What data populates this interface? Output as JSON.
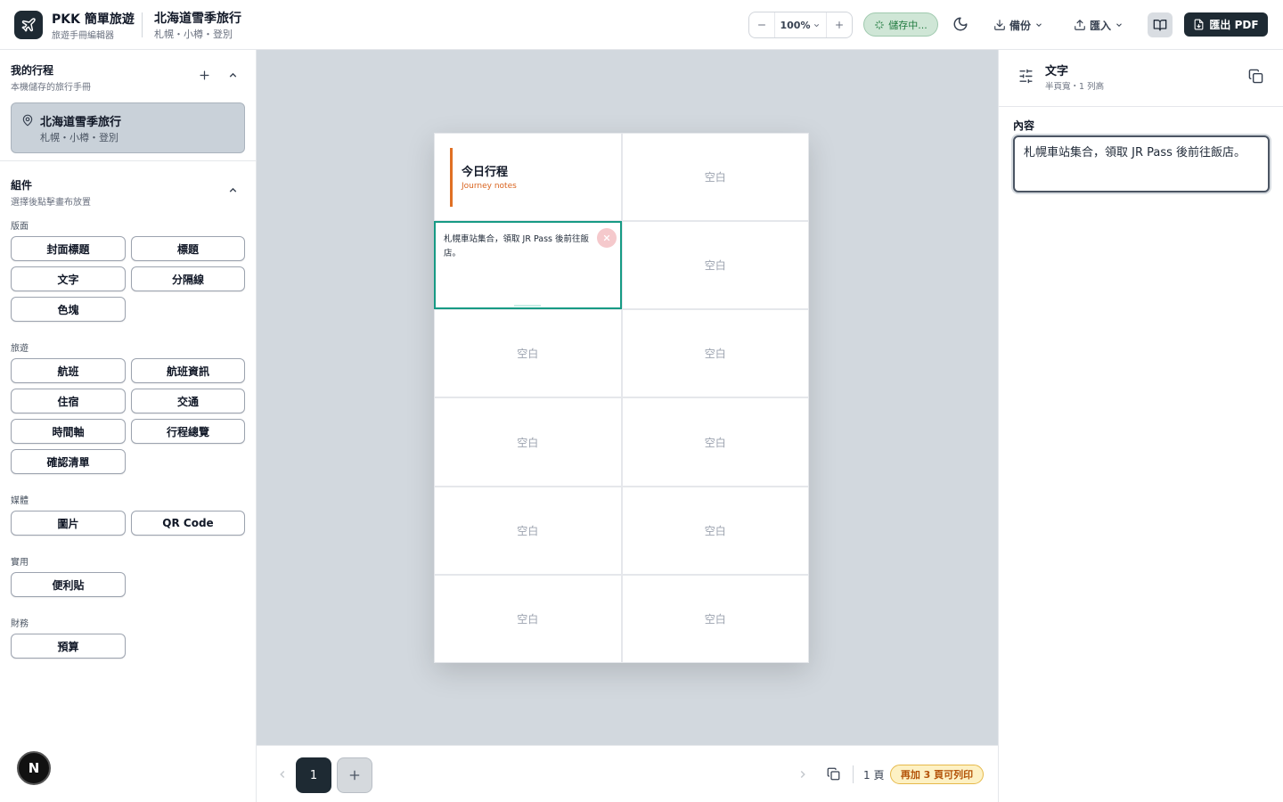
{
  "header": {
    "app_name": "PKK 簡單旅遊",
    "app_subtitle": "旅遊手冊編輯器",
    "trip_name": "北海道雪季旅行",
    "trip_locations": "札幌・小樽・登別",
    "zoom_value": "100%",
    "save_status": "儲存中...",
    "backup_label": "備份",
    "import_label": "匯入",
    "export_pdf_label": "匯出 PDF"
  },
  "sidebar": {
    "my_trips_title": "我的行程",
    "my_trips_subtitle": "本機儲存的旅行手冊",
    "trip_card": {
      "name": "北海道雪季旅行",
      "locations": "札幌・小樽・登別"
    },
    "components_title": "組件",
    "components_subtitle": "選擇後點擊畫布放置",
    "categories": [
      {
        "name": "版面",
        "items": [
          "封面標題",
          "標題",
          "文字",
          "分隔線",
          "色塊"
        ]
      },
      {
        "name": "旅遊",
        "items": [
          "航班",
          "航班資訊",
          "住宿",
          "交通",
          "時間軸",
          "行程總覽",
          "確認清單"
        ]
      },
      {
        "name": "媒體",
        "items": [
          "圖片",
          "QR Code"
        ]
      },
      {
        "name": "實用",
        "items": [
          "便利貼"
        ]
      },
      {
        "name": "財務",
        "items": [
          "預算"
        ]
      }
    ],
    "avatar_letter": "N"
  },
  "canvas": {
    "title_block": {
      "title": "今日行程",
      "subtitle": "Journey notes"
    },
    "selected_text": "札幌車站集合，領取 JR Pass 後前往飯店。",
    "empty_label": "空白"
  },
  "bottombar": {
    "current_page": "1",
    "page_count_label": "1 頁",
    "print_warning": "再加 3 頁可列印"
  },
  "inspector": {
    "title": "文字",
    "subtitle": "半頁寬・1 列高",
    "content_label": "內容",
    "content_value": "札幌車站集合，領取 JR Pass 後前往飯店。"
  },
  "colors": {
    "dark": "#1e2a33",
    "accent_orange": "#e07024",
    "selection_teal": "#169a84",
    "save_green": "#1f7a3e",
    "canvas_bg": "#d2d8de"
  },
  "icons": {
    "logo": "plane-icon",
    "zoom_out": "minus-icon",
    "zoom_in": "plus-icon",
    "theme": "moon-icon",
    "backup": "download-icon",
    "import": "upload-icon",
    "book": "book-open-icon",
    "pdf": "file-icon",
    "inspector": "sliders-icon",
    "duplicate": "copy-icon"
  }
}
